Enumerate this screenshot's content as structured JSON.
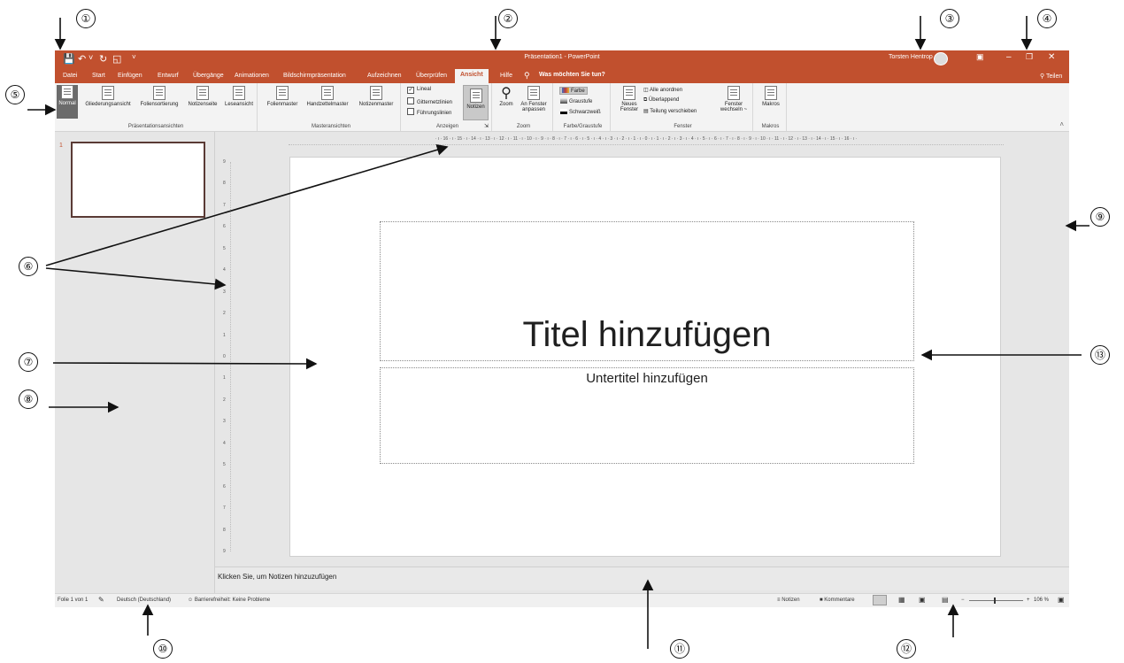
{
  "annotations": [
    "①",
    "②",
    "③",
    "④",
    "⑤",
    "⑥",
    "⑦",
    "⑧",
    "⑨",
    "⑩",
    "⑪",
    "⑫",
    "⑬"
  ],
  "window": {
    "title": "Präsentation1 - PowerPoint",
    "user": "Torsten Hentrop"
  },
  "qat": {
    "save_icon": "save-icon",
    "undo_icon": "undo-icon",
    "redo_icon": "redo-icon",
    "start_icon": "presentation-start-icon"
  },
  "tabs": [
    {
      "label": "Datei"
    },
    {
      "label": "Start"
    },
    {
      "label": "Einfügen"
    },
    {
      "label": "Entwurf"
    },
    {
      "label": "Übergänge"
    },
    {
      "label": "Animationen"
    },
    {
      "label": "Bildschirmpräsentation"
    },
    {
      "label": "Aufzeichnen"
    },
    {
      "label": "Überprüfen"
    },
    {
      "label": "Ansicht"
    },
    {
      "label": "Hilfe"
    }
  ],
  "tell_me": "Was möchten Sie tun?",
  "share": "Teilen",
  "ribbon": {
    "presentation_views": {
      "label": "Präsentationsansichten",
      "buttons": [
        "Normal",
        "Gliederungsansicht",
        "Foliensortierung",
        "Notizenseite",
        "Leseansicht"
      ]
    },
    "master_views": {
      "label": "Masteransichten",
      "buttons": [
        "Folienmaster",
        "Handzettelmaster",
        "Notizenmaster"
      ]
    },
    "show": {
      "label": "Anzeigen",
      "ruler": "Lineal",
      "gridlines": "Gitternetzlinien",
      "guides": "Führungslinien",
      "notes": "Notizen"
    },
    "zoom": {
      "label": "Zoom",
      "zoom": "Zoom",
      "fit_line1": "An Fenster",
      "fit_line2": "anpassen"
    },
    "color": {
      "label": "Farbe/Graustufe",
      "color": "Farbe",
      "grayscale": "Graustufe",
      "bw": "Schwarzweiß"
    },
    "window": {
      "label": "Fenster",
      "new_line1": "Neues",
      "new_line2": "Fenster",
      "arrange_all": "Alle anordnen",
      "cascade": "Überlappend",
      "move_split": "Teilung verschieben",
      "switch_line1": "Fenster",
      "switch_line2": "wechseln ~"
    },
    "macros": {
      "label": "Makros",
      "button": "Makros"
    }
  },
  "thumbnail": {
    "number": "1"
  },
  "ruler": {
    "horizontal": "· ı · 16 · ı · 15 · ı · 14 · ı · 13 · ı · 12 · ı · 11 · ı · 10 · ı · 9 · ı · 8 · ı · 7 · ı · 6 · ı · 5 · ı · 4 · ı · 3 · ı · 2 · ı · 1 · ı · 0 · ı · 1 · ı · 2 · ı · 3 · ı · 4 · ı · 5 · ı · 6 · ı · 7 · ı · 8 · ı · 9 · ı · 10 · ı · 11 · ı · 12 · ı · 13 · ı · 14 · ı · 15 · ı · 16 · ı ·",
    "vertical": [
      "9",
      "8",
      "7",
      "6",
      "5",
      "4",
      "3",
      "2",
      "1",
      "0",
      "1",
      "2",
      "3",
      "4",
      "5",
      "6",
      "7",
      "8",
      "9"
    ]
  },
  "slide": {
    "title_placeholder": "Titel hinzufügen",
    "subtitle_placeholder": "Untertitel hinzufügen"
  },
  "notes": {
    "placeholder": "Klicken Sie, um Notizen hinzuzufügen"
  },
  "status": {
    "slide_count": "Folie 1 von 1",
    "language": "Deutsch (Deutschland)",
    "accessibility": "Barrierefreiheit: Keine Probleme",
    "notes": "Notizen",
    "comments": "Kommentare",
    "zoom_minus": "−",
    "zoom_plus": "+",
    "zoom": "106 %"
  },
  "colors": {
    "accent": "#c1502e",
    "ribbon": "#f3f3f3",
    "workspace": "#e6e6e6"
  }
}
